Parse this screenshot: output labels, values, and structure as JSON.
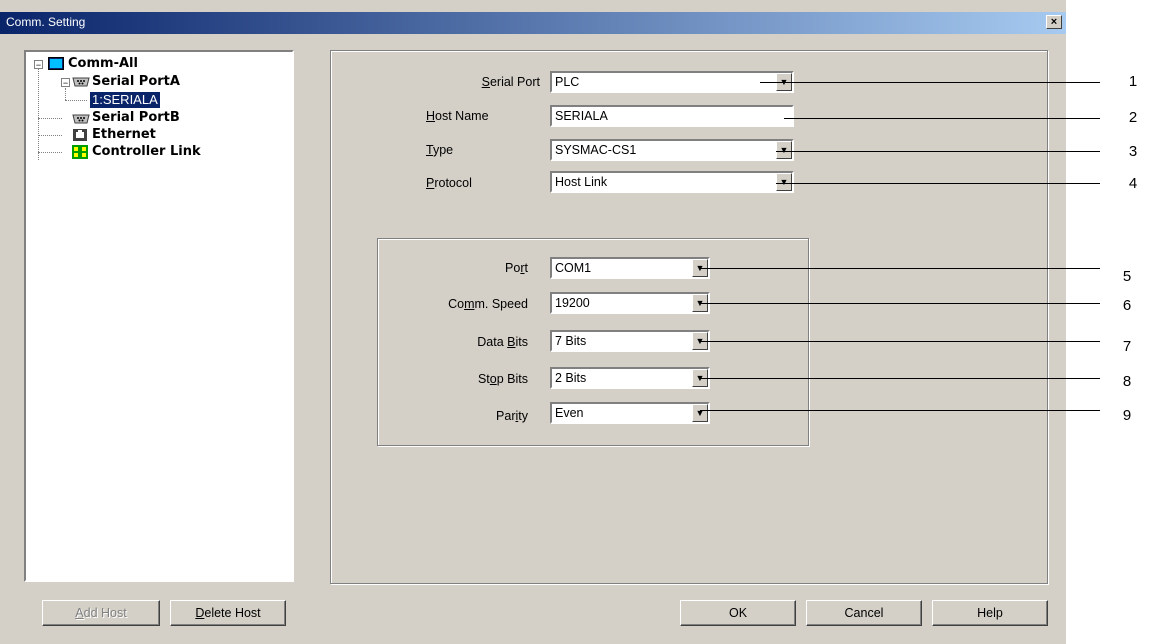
{
  "window": {
    "title": "Comm. Setting",
    "close": "×"
  },
  "tree": {
    "items": [
      {
        "label": "Comm-All",
        "expander": "−",
        "icon": "monitor-icon"
      },
      {
        "label": "Serial PortA",
        "expander": "−",
        "icon": "serial-port-icon"
      },
      {
        "label": "1:SERIALA",
        "selected": true
      },
      {
        "label": "Serial PortB",
        "icon": "serial-port-icon"
      },
      {
        "label": "Ethernet",
        "icon": "ethernet-icon"
      },
      {
        "label": "Controller Link",
        "icon": "controller-link-icon"
      }
    ]
  },
  "form": {
    "serial_port": {
      "label_u": "S",
      "label_rest": "erial Port",
      "value": "PLC"
    },
    "host_name": {
      "label_u": "H",
      "label_rest": "ost Name",
      "value": "SERIALA"
    },
    "type": {
      "label_u": "T",
      "label_rest": "ype",
      "value": "SYSMAC-CS1"
    },
    "protocol": {
      "label_u": "P",
      "label_rest": "rotocol",
      "value": "Host Link"
    }
  },
  "group": {
    "port": {
      "label_pre": "Po",
      "label_u": "r",
      "label_rest": "t",
      "value": "COM1"
    },
    "comm_speed": {
      "label_pre": "Co",
      "label_u": "m",
      "label_rest": "m. Speed",
      "value": "19200"
    },
    "data_bits": {
      "label_pre": "Data ",
      "label_u": "B",
      "label_rest": "its",
      "value": "7 Bits"
    },
    "stop_bits": {
      "label_pre": "St",
      "label_u": "o",
      "label_rest": "p Bits",
      "value": "2 Bits"
    },
    "parity": {
      "label_pre": "Par",
      "label_u": "i",
      "label_rest": "ty",
      "value": "Even"
    }
  },
  "buttons": {
    "add_host_u": "A",
    "add_host_rest": "dd Host",
    "delete_host_u": "D",
    "delete_host_rest": "elete Host",
    "ok": "OK",
    "cancel": "Cancel",
    "help": "Help"
  },
  "callouts": [
    "1",
    "2",
    "3",
    "4",
    "5",
    "6",
    "7",
    "8",
    "9"
  ]
}
